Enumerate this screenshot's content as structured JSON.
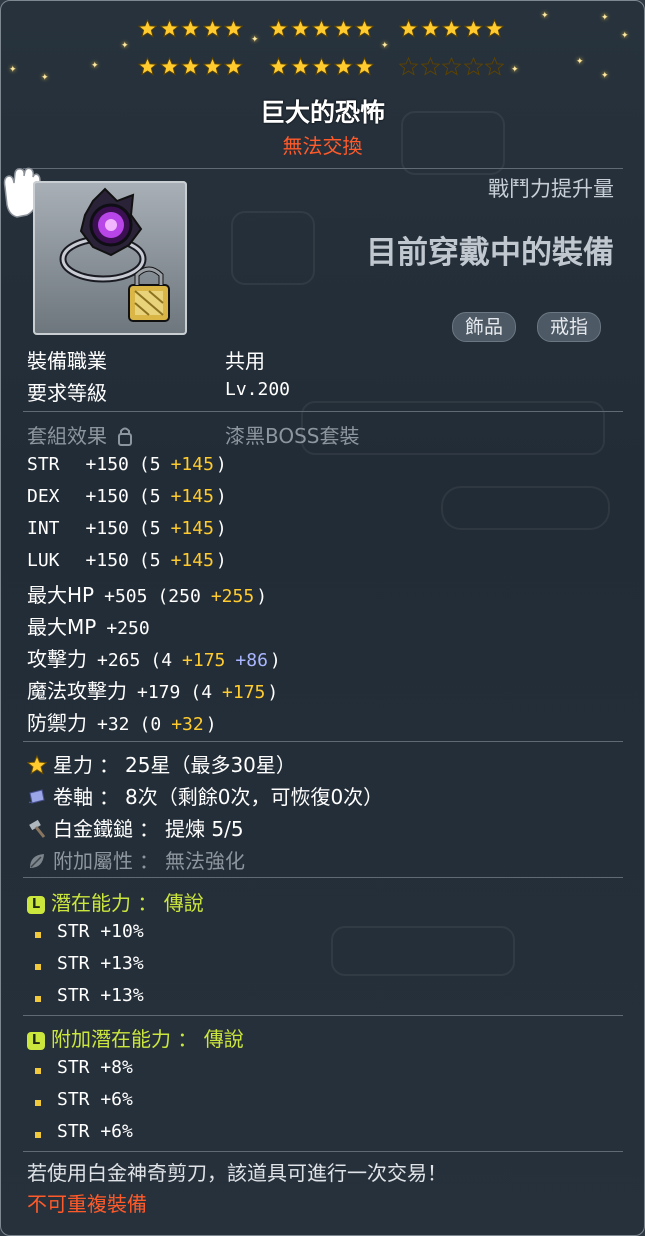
{
  "header": {
    "star_rows": [
      {
        "groups": [
          5,
          5,
          5
        ],
        "filled": 15
      },
      {
        "groups": [
          5,
          5,
          5
        ],
        "filled": 10
      }
    ],
    "title": "巨大的恐怖",
    "trade_status": "無法交換"
  },
  "item": {
    "combat_power_label": "戰鬥力提升量",
    "equipped_label": "目前穿戴中的裝備",
    "tags": [
      "飾品",
      "戒指"
    ],
    "icon": "dark-ring-icon"
  },
  "requirements": {
    "job_label": "裝備職業",
    "job_value": "共用",
    "level_label": "要求等級",
    "level_value": "Lv.200"
  },
  "set": {
    "label": "套組效果",
    "value": "漆黑BOSS套裝"
  },
  "stats": [
    {
      "name": "STR",
      "total": "+150",
      "base": "(5",
      "bonus": "+145",
      "extra": "",
      "close": ")"
    },
    {
      "name": "DEX",
      "total": "+150",
      "base": "(5",
      "bonus": "+145",
      "extra": "",
      "close": ")"
    },
    {
      "name": "INT",
      "total": "+150",
      "base": "(5",
      "bonus": "+145",
      "extra": "",
      "close": ")"
    },
    {
      "name": "LUK",
      "total": "+150",
      "base": "(5",
      "bonus": "+145",
      "extra": "",
      "close": ")"
    },
    {
      "name": "最大HP",
      "total": "+505",
      "base": "(250",
      "bonus": "+255",
      "extra": "",
      "close": ")"
    },
    {
      "name": "最大MP",
      "total": "+250",
      "base": "",
      "bonus": "",
      "extra": "",
      "close": ""
    },
    {
      "name": "攻擊力",
      "total": "+265",
      "base": "(4",
      "bonus": "+175",
      "extra": "+86",
      "close": ")"
    },
    {
      "name": "魔法攻擊力",
      "total": "+179",
      "base": "(4",
      "bonus": "+175",
      "extra": "",
      "close": ")"
    },
    {
      "name": "防禦力",
      "total": "+32",
      "base": "(0",
      "bonus": "+32",
      "extra": "",
      "close": ")"
    }
  ],
  "enhancements": [
    {
      "icon": "star-icon",
      "label": "星力",
      "sep": "：",
      "value": "25星（最多30星）",
      "dim": false
    },
    {
      "icon": "scroll-icon",
      "label": "卷軸",
      "sep": "：",
      "value": "8次（剩餘0次，可恢復0次）",
      "dim": false
    },
    {
      "icon": "hammer-icon",
      "label": "白金鐵鎚",
      "sep": "：",
      "value": "提煉 5/5",
      "dim": false
    },
    {
      "icon": "leaf-icon",
      "label": "附加屬性",
      "sep": "：",
      "value": "無法強化",
      "dim": true
    }
  ],
  "potential": {
    "badge": "L",
    "label": "潛在能力",
    "sep": "：",
    "grade": "傳說",
    "lines": [
      "STR +10%",
      "STR +13%",
      "STR +13%"
    ],
    "bullet_color": "#f3c93c"
  },
  "additional_potential": {
    "badge": "L",
    "label": "附加潛在能力",
    "sep": "：",
    "grade": "傳說",
    "lines": [
      "STR +8%",
      "STR +6%",
      "STR +6%"
    ],
    "bullet_color": "#f3c93c"
  },
  "footer": {
    "note": "若使用白金神奇剪刀，該道具可進行一次交易！",
    "warning": "不可重複裝備"
  },
  "colors": {
    "star_filled": "#ffcb2e",
    "star_empty": "#2a3038",
    "bonus": "#ffcb2e",
    "extra": "#a9b6ff",
    "potential": "#cbe63d",
    "warning": "#ff5a2a"
  }
}
